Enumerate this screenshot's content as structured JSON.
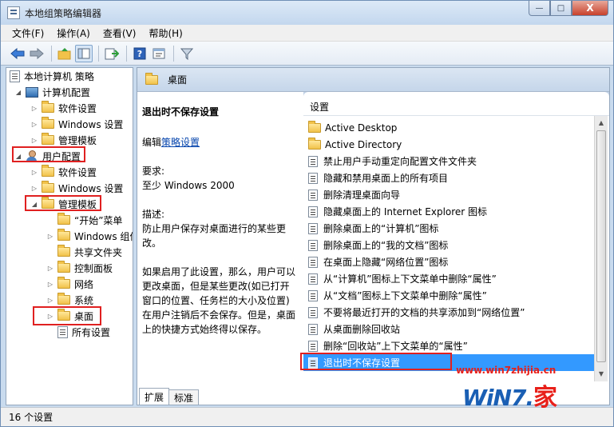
{
  "window": {
    "title": "本地组策略编辑器",
    "controls": {
      "minimize": "—",
      "maximize": "□",
      "close": "X"
    }
  },
  "menu": [
    "文件(F)",
    "操作(A)",
    "查看(V)",
    "帮助(H)"
  ],
  "toolbar_icons": [
    "back-arrow-icon",
    "forward-arrow-icon",
    "up-folder-icon",
    "show-tree-icon",
    "export-list-icon",
    "help-icon",
    "properties-icon",
    "filter-icon"
  ],
  "tree": [
    {
      "label": "本地计算机 策略",
      "icon": "doc",
      "indent": 0,
      "arrow": ""
    },
    {
      "label": "计算机配置",
      "icon": "pc",
      "indent": 1,
      "arrow": "◢"
    },
    {
      "label": "软件设置",
      "icon": "folder",
      "indent": 2,
      "arrow": "▷"
    },
    {
      "label": "Windows 设置",
      "icon": "folder",
      "indent": 2,
      "arrow": "▷"
    },
    {
      "label": "管理模板",
      "icon": "folder",
      "indent": 2,
      "arrow": "▷"
    },
    {
      "label": "用户配置",
      "icon": "user",
      "indent": 0,
      "arrow": "◢"
    },
    {
      "label": "软件设置",
      "icon": "folder",
      "indent": 2,
      "arrow": "▷"
    },
    {
      "label": "Windows 设置",
      "icon": "folder",
      "indent": 2,
      "arrow": "▷"
    },
    {
      "label": "管理模板",
      "icon": "folder",
      "indent": 2,
      "arrow": "◢"
    },
    {
      "label": "“开始”菜单",
      "icon": "folder",
      "indent": 3,
      "arrow": ""
    },
    {
      "label": "Windows 组件",
      "icon": "folder",
      "indent": 3,
      "arrow": "▷"
    },
    {
      "label": "共享文件夹",
      "icon": "folder",
      "indent": 3,
      "arrow": ""
    },
    {
      "label": "控制面板",
      "icon": "folder",
      "indent": 3,
      "arrow": "▷"
    },
    {
      "label": "网络",
      "icon": "folder",
      "indent": 3,
      "arrow": "▷"
    },
    {
      "label": "系统",
      "icon": "folder",
      "indent": 3,
      "arrow": "▷"
    },
    {
      "label": "桌面",
      "icon": "folder",
      "indent": 3,
      "arrow": "▷"
    },
    {
      "label": "所有设置",
      "icon": "doc",
      "indent": 3,
      "arrow": ""
    }
  ],
  "right_header": "桌面",
  "description": {
    "title": "退出时不保存设置",
    "edit_prefix": "编辑",
    "edit_link": "策略设置",
    "requirement_label": "要求:",
    "requirement_value": "至少 Windows 2000",
    "desc_label": "描述:",
    "desc_text": "防止用户保存对桌面进行的某些更改。",
    "desc_more": "如果启用了此设置，那么，用户可以更改桌面，但是某些更改(如已打开窗口的位置、任务栏的大小及位置)在用户注销后不会保存。但是，桌面上的快捷方式始终得以保存。"
  },
  "list": {
    "header": "设置",
    "items": [
      {
        "label": "Active Desktop",
        "type": "folder"
      },
      {
        "label": "Active Directory",
        "type": "folder"
      },
      {
        "label": "禁止用户手动重定向配置文件文件夹",
        "type": "setting"
      },
      {
        "label": "隐藏和禁用桌面上的所有项目",
        "type": "setting"
      },
      {
        "label": "删除清理桌面向导",
        "type": "setting"
      },
      {
        "label": "隐藏桌面上的 Internet Explorer 图标",
        "type": "setting"
      },
      {
        "label": "删除桌面上的“计算机”图标",
        "type": "setting"
      },
      {
        "label": "删除桌面上的“我的文档”图标",
        "type": "setting"
      },
      {
        "label": "在桌面上隐藏“网络位置”图标",
        "type": "setting"
      },
      {
        "label": "从“计算机”图标上下文菜单中删除“属性”",
        "type": "setting"
      },
      {
        "label": "从“文档”图标上下文菜单中删除“属性”",
        "type": "setting"
      },
      {
        "label": "不要将最近打开的文档的共享添加到“网络位置”",
        "type": "setting"
      },
      {
        "label": "从桌面删除回收站",
        "type": "setting"
      },
      {
        "label": "删除“回收站”上下文菜单的“属性”",
        "type": "setting"
      },
      {
        "label": "退出时不保存设置",
        "type": "setting",
        "selected": true
      }
    ]
  },
  "tabs": [
    "扩展",
    "标准"
  ],
  "status": "16 个设置",
  "watermark": {
    "url": "www.win7zhijia.cn",
    "logo_text": "WiN7.",
    "logo_char": "家"
  },
  "colors": {
    "highlight_box": "#e02020",
    "selection": "#3399ff",
    "link": "#0645ad"
  }
}
